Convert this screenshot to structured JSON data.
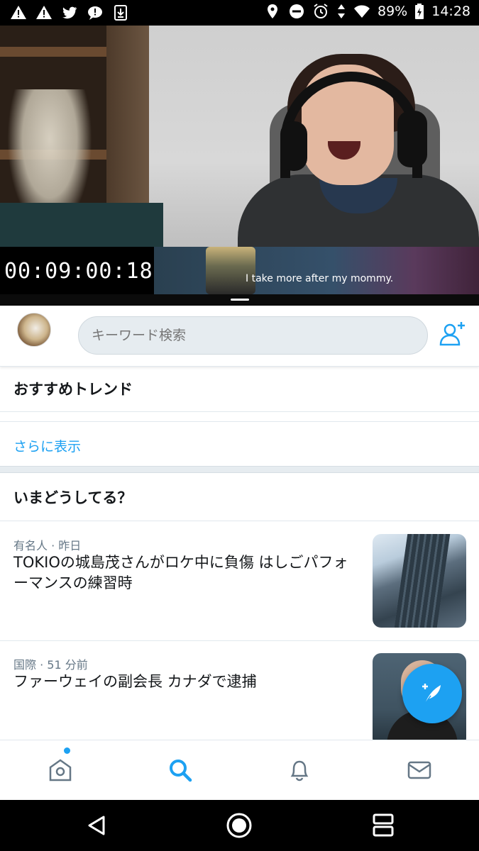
{
  "status_bar": {
    "battery": "89%",
    "time": "14:28",
    "left_icons": [
      "warning-icon",
      "warning-icon",
      "twitter-bird-icon",
      "chat-bubble-icon",
      "download-icon"
    ],
    "right_icons": [
      "location-icon",
      "do-not-disturb-icon",
      "alarm-icon",
      "data-arrows-icon",
      "wifi-icon",
      "battery-icon"
    ]
  },
  "video": {
    "timecode": "00:09:00:18",
    "subtitle": "I take more after my mommy."
  },
  "header": {
    "search_placeholder": "キーワード検索"
  },
  "trends": {
    "title": "おすすめトレンド",
    "more_link": "さらに表示"
  },
  "happening": {
    "title": "いまどうしてる？",
    "items": [
      {
        "meta": "有名人 · 昨日",
        "headline": "TOKIOの城島茂さんがロケ中に負傷 はしごパフォーマンスの練習時"
      },
      {
        "meta": "国際 · 51 分前",
        "headline": "ファーウェイの副会長 カナダで逮捕"
      }
    ]
  },
  "colors": {
    "accent": "#1da1f2",
    "text_primary": "#14171a",
    "text_secondary": "#657786"
  },
  "bottom_nav": [
    "home-icon",
    "search-icon",
    "notifications-icon",
    "messages-icon"
  ],
  "android_nav": [
    "back-icon",
    "home-circle-icon",
    "recents-icon"
  ]
}
